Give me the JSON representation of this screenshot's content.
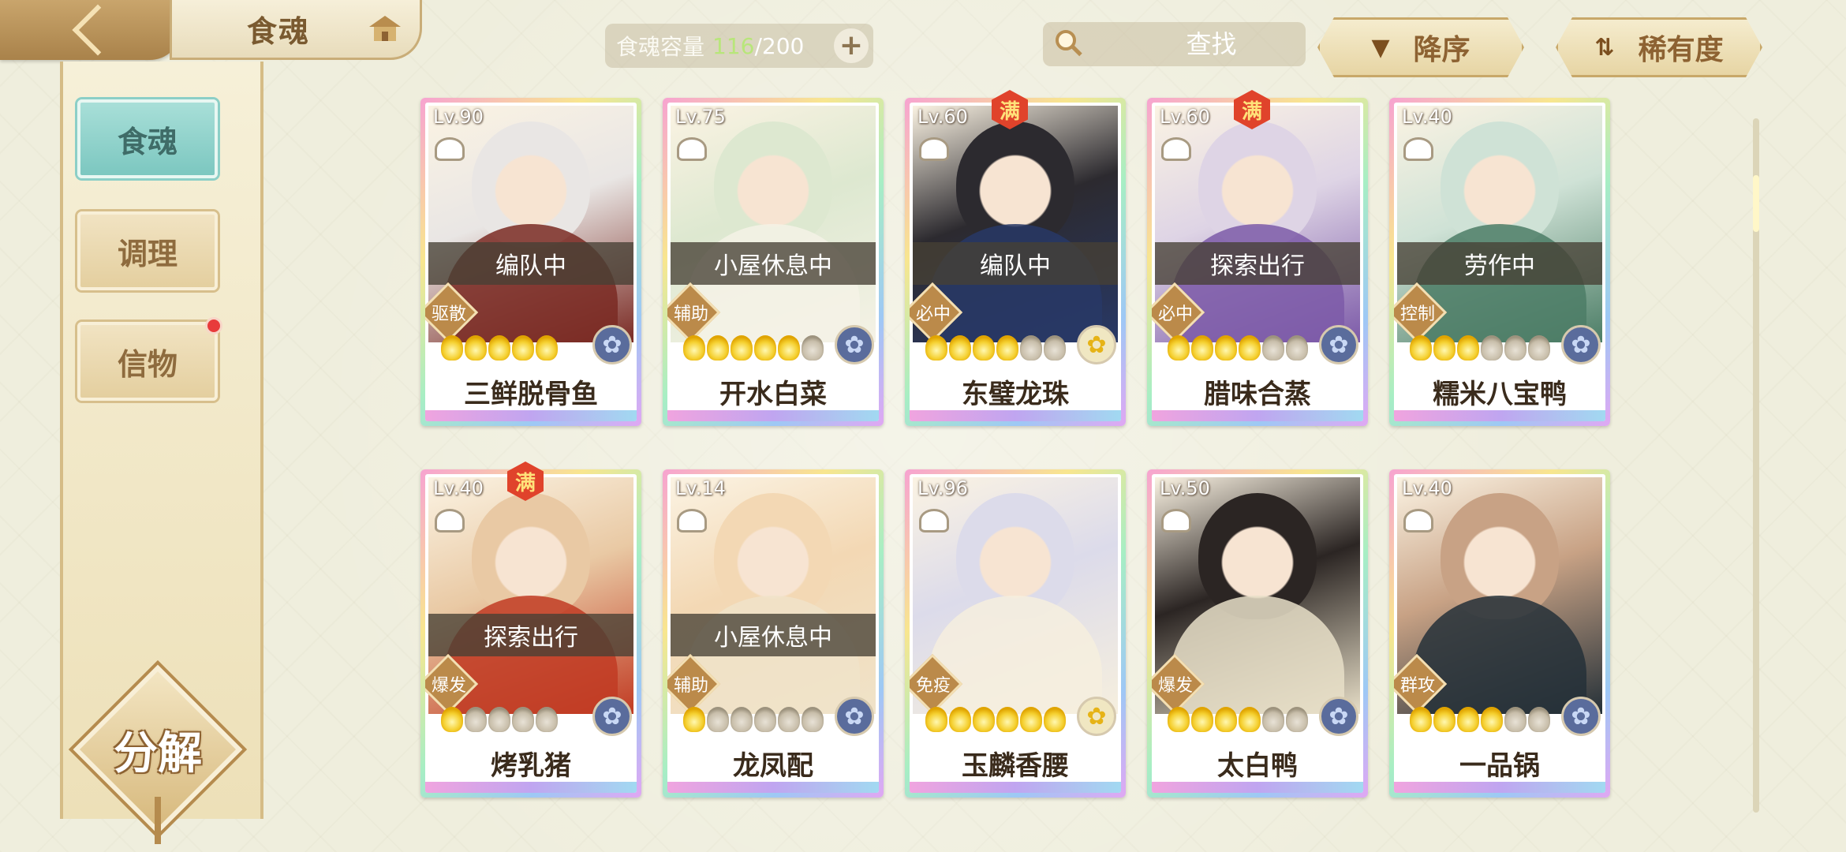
{
  "header": {
    "title": "食魂",
    "capacity_label": "食魂容量",
    "capacity_used": "116",
    "capacity_total": "/200",
    "add_symbol": "+",
    "search_placeholder": "查找",
    "clear_symbol": "✕",
    "sort_order_label": "降序",
    "sort_field_label": "稀有度"
  },
  "sidebar": {
    "tabs": [
      {
        "label": "食魂",
        "active": true
      },
      {
        "label": "调理",
        "active": false
      },
      {
        "label": "信物",
        "active": false,
        "has_notification": true
      }
    ],
    "decompose_label": "分解"
  },
  "cards": [
    {
      "level": "Lv.90",
      "status": "编队中",
      "role": "驱散",
      "name": "三鲜脱骨鱼",
      "stars_filled": 5,
      "stars_total": 5,
      "max": false,
      "element": "blue",
      "palette": [
        "#e9e6e4",
        "#7a2a23"
      ]
    },
    {
      "level": "Lv.75",
      "status": "小屋休息中",
      "role": "辅助",
      "name": "开水白菜",
      "stars_filled": 5,
      "stars_total": 6,
      "max": false,
      "element": "blue",
      "palette": [
        "#dde8d0",
        "#f5f2e6"
      ]
    },
    {
      "level": "Lv.60",
      "status": "编队中",
      "role": "必中",
      "name": "东璧龙珠",
      "stars_filled": 4,
      "stars_total": 6,
      "max": true,
      "max_label": "满",
      "element": "gold",
      "palette": [
        "#2c2a2f",
        "#283866"
      ]
    },
    {
      "level": "Lv.60",
      "status": "探索出行",
      "role": "必中",
      "name": "腊味合蒸",
      "stars_filled": 4,
      "stars_total": 6,
      "max": true,
      "max_label": "满",
      "element": "blue",
      "palette": [
        "#ded4e5",
        "#7c5aa8"
      ]
    },
    {
      "level": "Lv.40",
      "status": "劳作中",
      "role": "控制",
      "name": "糯米八宝鸭",
      "stars_filled": 3,
      "stars_total": 6,
      "max": false,
      "element": "blue",
      "palette": [
        "#cfe2d6",
        "#4c7d66"
      ]
    },
    {
      "level": "Lv.40",
      "status": "探索出行",
      "role": "爆发",
      "name": "烤乳猪",
      "stars_filled": 1,
      "stars_total": 5,
      "max": true,
      "max_label": "满",
      "element": "blue",
      "palette": [
        "#e9c9a4",
        "#c13b23"
      ]
    },
    {
      "level": "Lv.14",
      "status": "小屋休息中",
      "role": "辅助",
      "name": "龙凤配",
      "stars_filled": 1,
      "stars_total": 6,
      "max": false,
      "element": "blue",
      "palette": [
        "#f3d8b4",
        "#f0e3c9"
      ]
    },
    {
      "level": "Lv.96",
      "status": "",
      "role": "免疫",
      "name": "玉麟香腰",
      "stars_filled": 6,
      "stars_total": 6,
      "max": false,
      "element": "gold",
      "palette": [
        "#dcdbea",
        "#f6efde"
      ]
    },
    {
      "level": "Lv.50",
      "status": "",
      "role": "爆发",
      "name": "太白鸭",
      "stars_filled": 4,
      "stars_total": 6,
      "max": false,
      "element": "blue",
      "palette": [
        "#2b2523",
        "#e8dfc8"
      ]
    },
    {
      "level": "Lv.40",
      "status": "",
      "role": "群攻",
      "name": "一品锅",
      "stars_filled": 4,
      "stars_total": 6,
      "max": false,
      "element": "blue",
      "palette": [
        "#c8a285",
        "#243038"
      ]
    }
  ]
}
